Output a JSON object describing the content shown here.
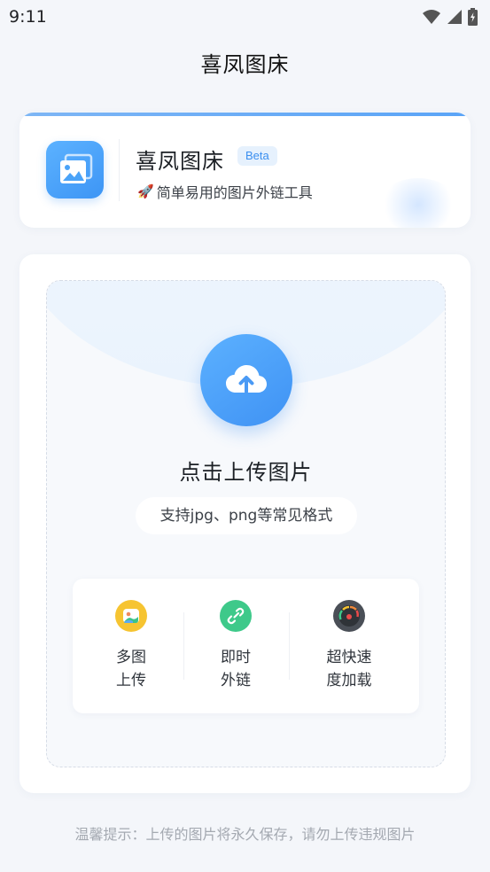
{
  "status_bar": {
    "time": "9:11",
    "icons": [
      "wifi-icon",
      "signal-icon",
      "battery-charging-icon"
    ]
  },
  "header": {
    "title": "喜凤图床"
  },
  "brand": {
    "name": "喜凤图床",
    "badge": "Beta",
    "tagline_icon": "🚀",
    "tagline": "简单易用的图片外链工具",
    "logo_icon": "images-icon",
    "accent_color": "#3d95f5"
  },
  "upload": {
    "button_icon": "cloud-upload-icon",
    "title": "点击上传图片",
    "formats": "支持jpg、png等常见格式",
    "features": [
      {
        "icon": "gallery-icon",
        "line1": "多图",
        "line2": "上传",
        "color": "#f6c431"
      },
      {
        "icon": "link-icon",
        "line1": "即时",
        "line2": "外链",
        "color": "#3ec98a"
      },
      {
        "icon": "speedometer-icon",
        "line1": "超快速",
        "line2": "度加载",
        "color": "#4a4f57"
      }
    ]
  },
  "footer": {
    "tip": "温馨提示：上传的图片将永久保存，请勿上传违规图片"
  }
}
